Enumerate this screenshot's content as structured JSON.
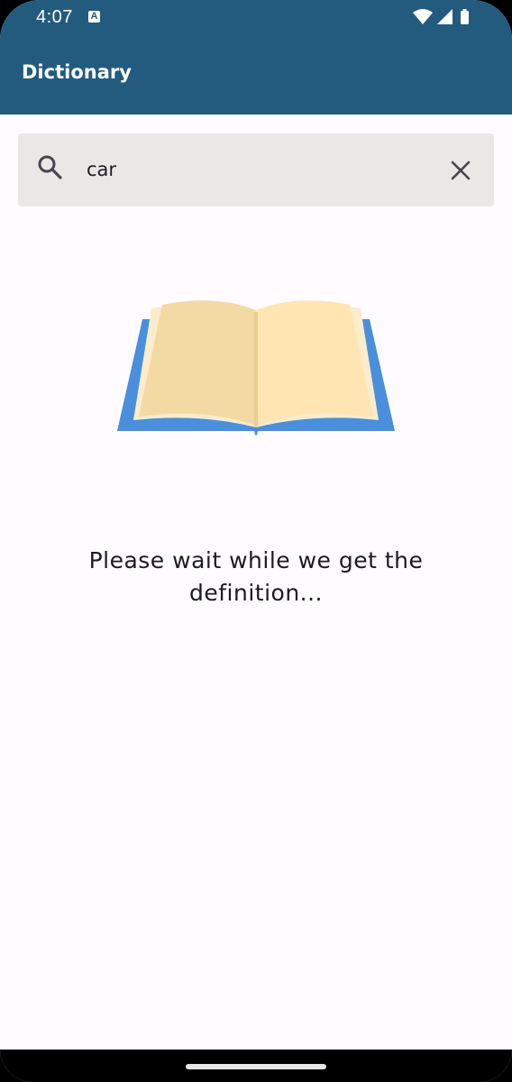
{
  "status_bar": {
    "time": "4:07",
    "notification_icon_letter": "A",
    "icons": [
      "wifi-icon",
      "cell-signal-icon",
      "battery-icon"
    ]
  },
  "app_bar": {
    "title": "Dictionary",
    "color": "#225b7e"
  },
  "search": {
    "value": "car",
    "search_icon": "search-icon",
    "clear_icon": "close-icon",
    "background": "#ebe7e6"
  },
  "main": {
    "illustration": "open-book-icon",
    "loading_message": "Please wait while we get the definition..."
  },
  "colors": {
    "background": "#fffbfe",
    "text": "#1c1b1f",
    "book_cover": "#4a8fdc",
    "book_page_left": "#f3d9a4",
    "book_page_right": "#fee5b2"
  }
}
